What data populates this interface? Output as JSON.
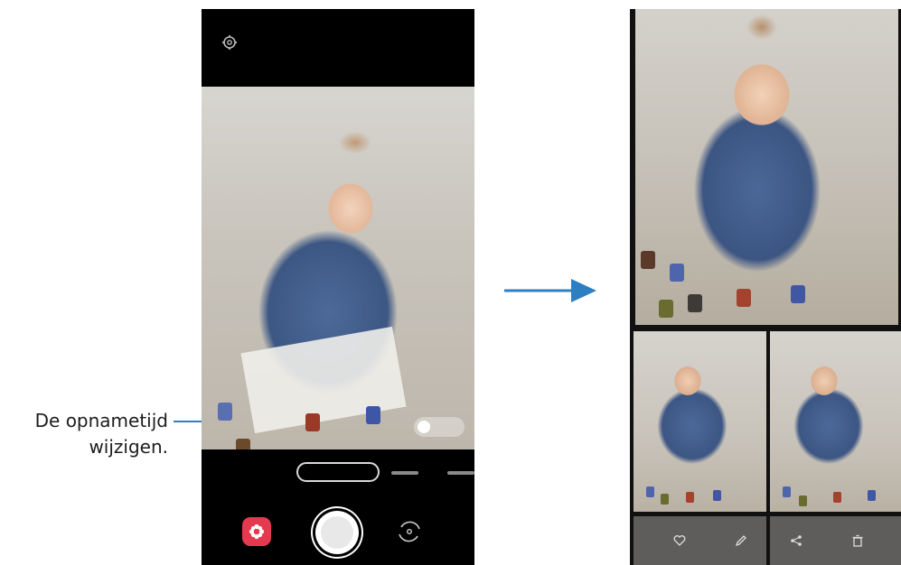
{
  "callout": {
    "line1": "De opnametijd",
    "line2": "wijzigen."
  },
  "camera": {
    "top_icon": "settings-icon",
    "timer_label": "",
    "mode_label": "",
    "effect_icon": "effect-flower-icon",
    "switch_icon": "switch-camera-icon"
  },
  "result": {
    "tools": [
      "heart-icon",
      "edit-icon",
      "share-icon",
      "delete-icon"
    ]
  },
  "colors": {
    "accent": "#2d7fc1",
    "effect_button": "#e43a50"
  }
}
